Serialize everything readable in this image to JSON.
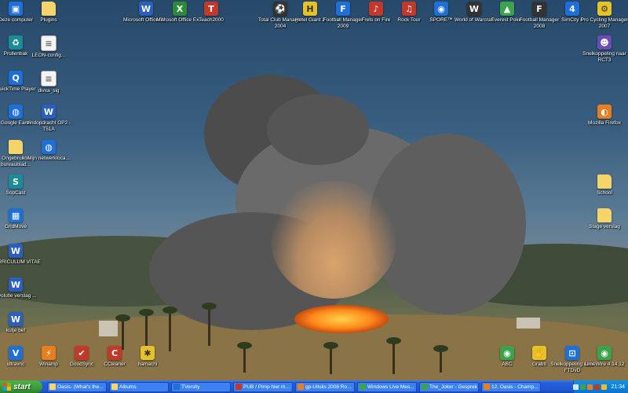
{
  "desktop": {
    "icons": [
      {
        "name": "icon-my-computer",
        "label": "Deze computer",
        "glyph": "▣",
        "style": "blue"
      },
      {
        "name": "icon-plugins",
        "label": "Plugins",
        "glyph": "",
        "style": "folder"
      },
      {
        "name": "icon-ms-word",
        "label": "Microsoft Office W...",
        "glyph": "W",
        "style": "word"
      },
      {
        "name": "icon-ms-excel",
        "label": "Microsoft Office Ex...",
        "glyph": "X",
        "style": "excel"
      },
      {
        "name": "icon-teach2000",
        "label": "Teach2000",
        "glyph": "T",
        "style": "red"
      },
      {
        "name": "icon-total-club-manager",
        "label": "Total Club Manager 2004",
        "glyph": "⚽",
        "style": "dark"
      },
      {
        "name": "icon-hotel-giant",
        "label": "Hotel Giant 2",
        "glyph": "H",
        "style": "yellow"
      },
      {
        "name": "icon-football-manager-2009",
        "label": "Football Manager 2009",
        "glyph": "F",
        "style": "blue"
      },
      {
        "name": "icon-frets-on-fire",
        "label": "Frets on Fire",
        "glyph": "♪",
        "style": "red"
      },
      {
        "name": "icon-rock-tour",
        "label": "Rock Tour",
        "glyph": "♫",
        "style": "red"
      },
      {
        "name": "icon-spore",
        "label": "SPORE™",
        "glyph": "◉",
        "style": "blue"
      },
      {
        "name": "icon-world-of-warcraft",
        "label": "World of Warcraft",
        "glyph": "W",
        "style": "dark"
      },
      {
        "name": "icon-everest-poker",
        "label": "Everest Poker",
        "glyph": "▲",
        "style": "green"
      },
      {
        "name": "icon-football-manager-2008",
        "label": "Football Manager 2008",
        "glyph": "F",
        "style": "dark"
      },
      {
        "name": "icon-simcity-4",
        "label": "SimCity 4",
        "glyph": "4",
        "style": "blue"
      },
      {
        "name": "icon-pro-cycling-manager",
        "label": "Pro Cycling Manager 2007",
        "glyph": "⚙",
        "style": "yellow"
      },
      {
        "name": "icon-recycle-bin",
        "label": "Prullenbak",
        "glyph": "♻",
        "style": "teal"
      },
      {
        "name": "icon-leon-config",
        "label": "LEON-config...",
        "glyph": "≡",
        "style": "doc"
      },
      {
        "name": "icon-rct3-shortcut",
        "label": "Snelkoppeling naar RCT3",
        "glyph": "☻",
        "style": "purple"
      },
      {
        "name": "icon-quicktime",
        "label": "QuickTime Player",
        "glyph": "Q",
        "style": "blue"
      },
      {
        "name": "icon-divxa-sig",
        "label": "divxa_sig",
        "glyph": "≡",
        "style": "doc"
      },
      {
        "name": "icon-google-earth",
        "label": "Google Earth",
        "glyph": "◍",
        "style": "blue"
      },
      {
        "name": "icon-eindopdracht",
        "label": "eindopdracht OP2 - T51A",
        "glyph": "W",
        "style": "word"
      },
      {
        "name": "icon-firefox",
        "label": "Mozilla Firefox",
        "glyph": "◐",
        "style": "orange"
      },
      {
        "name": "icon-unused-desktop",
        "label": "Ongebruikte bureaublad...",
        "glyph": "",
        "style": "folder"
      },
      {
        "name": "icon-network-places",
        "label": "Mijn netwerkloca...",
        "glyph": "◍",
        "style": "blue"
      },
      {
        "name": "icon-school",
        "label": "School",
        "glyph": "",
        "style": "folder"
      },
      {
        "name": "icon-sopcast",
        "label": "SopCast",
        "glyph": "S",
        "style": "teal"
      },
      {
        "name": "icon-gridmove",
        "label": "GridMove",
        "glyph": "▦",
        "style": "blue"
      },
      {
        "name": "icon-stage-verslag",
        "label": "Stage verslag",
        "glyph": "",
        "style": "folder"
      },
      {
        "name": "icon-curriculum-vitae",
        "label": "CURRICULUM VITAE",
        "glyph": "W",
        "style": "word"
      },
      {
        "name": "icon-evolutie-verslag",
        "label": "Evolutie verslag ...",
        "glyph": "W",
        "style": "word"
      },
      {
        "name": "icon-kutje-bef",
        "label": "kutje bef",
        "glyph": "W",
        "style": "word"
      },
      {
        "name": "icon-ultravnc",
        "label": "ultravnc",
        "glyph": "V",
        "style": "blue"
      },
      {
        "name": "icon-winamp",
        "label": "Winamp",
        "glyph": "⚡",
        "style": "orange"
      },
      {
        "name": "icon-goodsync",
        "label": "GoodSync",
        "glyph": "✔",
        "style": "red"
      },
      {
        "name": "icon-ccleaner",
        "label": "CCleaner",
        "glyph": "C",
        "style": "red"
      },
      {
        "name": "icon-hamachi",
        "label": "hamachi",
        "glyph": "✱",
        "style": "yellow"
      },
      {
        "name": "icon-abc",
        "label": "ABC",
        "glyph": "◉",
        "style": "green"
      },
      {
        "name": "icon-grabit",
        "label": "GrabIt",
        "glyph": "✋",
        "style": "yellow"
      },
      {
        "name": "icon-ftdv-shortcut",
        "label": "Snelkoppeling naar FTDvD",
        "glyph": "⊡",
        "style": "blue"
      },
      {
        "name": "icon-limewire",
        "label": "LimeWire 4.14.12",
        "glyph": "◉",
        "style": "green"
      }
    ]
  },
  "taskbar": {
    "start_label": "start",
    "tasks": [
      {
        "label": "Oasis- (What's the...",
        "color": "#f5d46a"
      },
      {
        "label": "Albums",
        "color": "#f5d46a"
      },
      {
        "label": "TVersity",
        "color": "#1e6fd6"
      },
      {
        "label": "PUB / Pimp hier me...",
        "color": "#c0392b"
      },
      {
        "label": "gp-Uitslis 2008 Roo...",
        "color": "#e67e22"
      },
      {
        "label": "Windows Live Mes...",
        "color": "#3aa34b"
      },
      {
        "label": "The_Joker - Gesprek",
        "color": "#3aa34b"
      },
      {
        "label": "12. Oasis - Champ...",
        "color": "#e67e22"
      }
    ],
    "clock": "21:34",
    "tray_colors": [
      "#d6e4f5",
      "#3aa34b",
      "#e67e22",
      "#c0392b",
      "#e5c22a"
    ]
  }
}
